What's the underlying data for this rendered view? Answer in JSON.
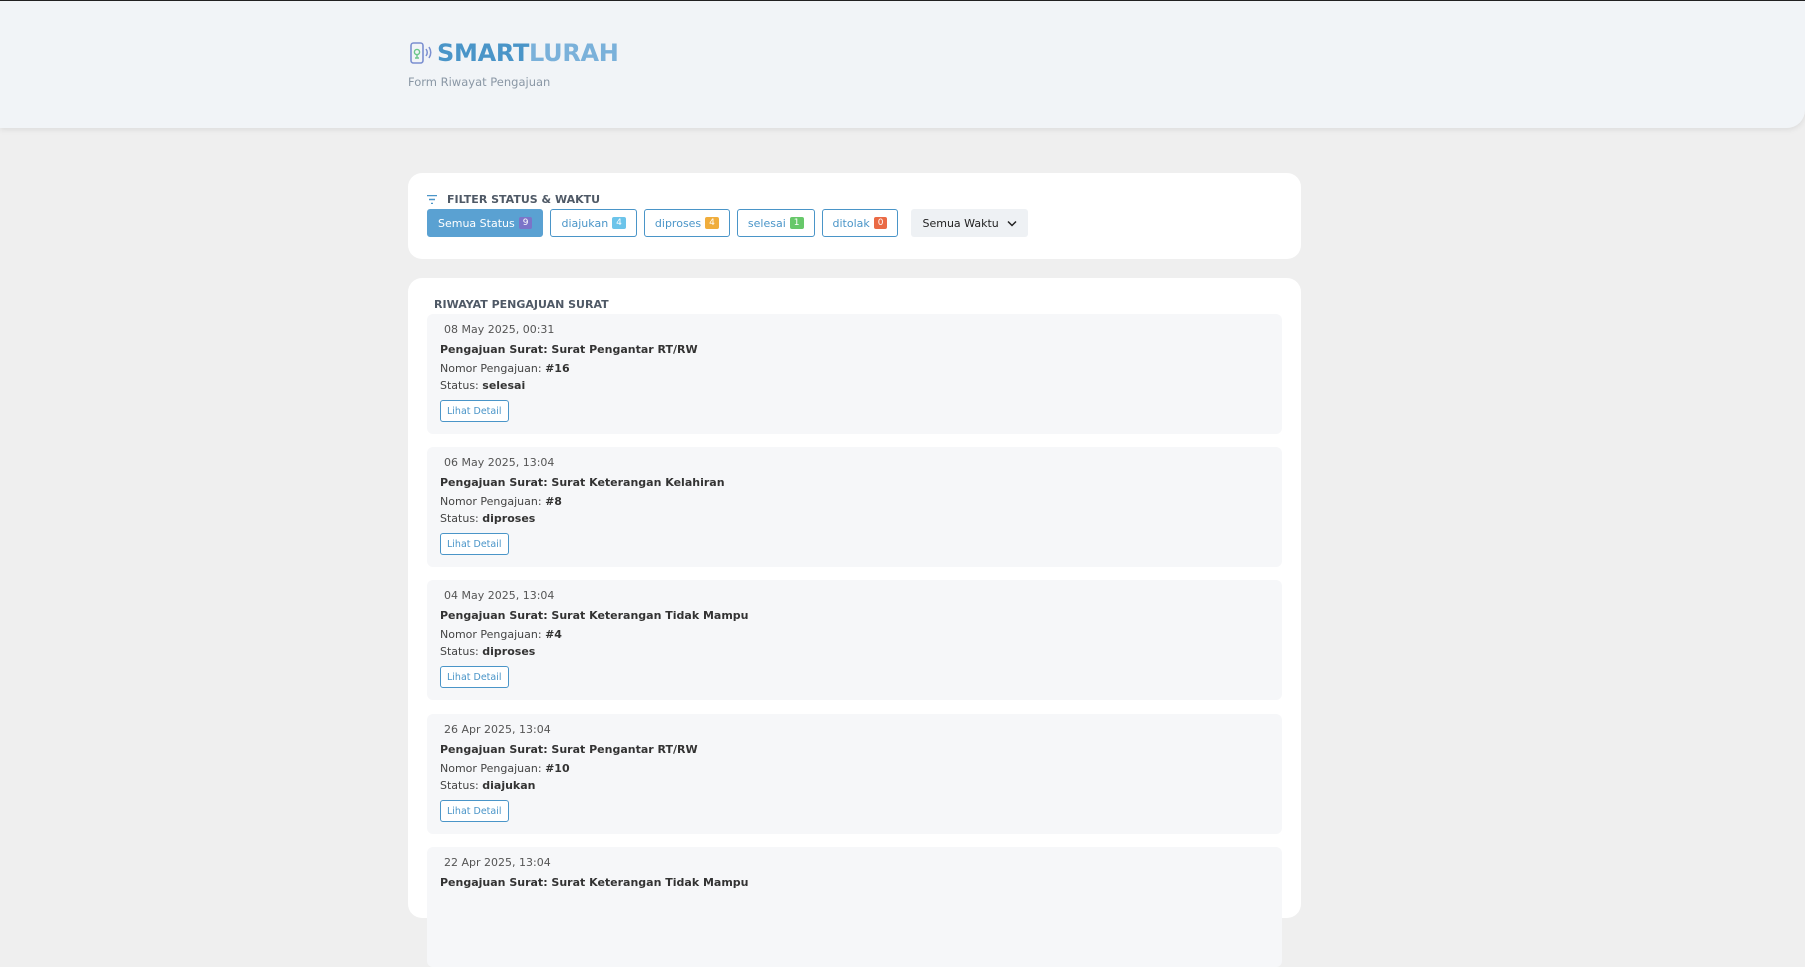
{
  "header": {
    "brand_part1": "SMART",
    "brand_part2": "LURAH",
    "subtitle": "Form Riwayat Pengajuan"
  },
  "filter": {
    "title": "FILTER STATUS & WAKTU",
    "chips": [
      {
        "label": "Semua Status",
        "count": "9",
        "active": true,
        "badge_color": "#7b74c8"
      },
      {
        "label": "diajukan",
        "count": "4",
        "active": false,
        "badge_color": "#6cc4ea"
      },
      {
        "label": "diproses",
        "count": "4",
        "active": false,
        "badge_color": "#f0ad3c"
      },
      {
        "label": "selesai",
        "count": "1",
        "active": false,
        "badge_color": "#67c86a"
      },
      {
        "label": "ditolak",
        "count": "0",
        "active": false,
        "badge_color": "#ea6a45"
      }
    ],
    "time_select_value": "Semua Waktu"
  },
  "history": {
    "title": "RIWAYAT PENGAJUAN SURAT",
    "nomor_label": "Nomor Pengajuan:",
    "status_label": "Status:",
    "detail_label": "Lihat Detail",
    "items": [
      {
        "date": "08 May 2025, 00:31",
        "title": "Pengajuan Surat: Surat Pengantar RT/RW",
        "nomor": "#16",
        "status": "selesai"
      },
      {
        "date": "06 May 2025, 13:04",
        "title": "Pengajuan Surat: Surat Keterangan Kelahiran",
        "nomor": "#8",
        "status": "diproses"
      },
      {
        "date": "04 May 2025, 13:04",
        "title": "Pengajuan Surat: Surat Keterangan Tidak Mampu",
        "nomor": "#4",
        "status": "diproses"
      },
      {
        "date": "26 Apr 2025, 13:04",
        "title": "Pengajuan Surat: Surat Pengantar RT/RW",
        "nomor": "#10",
        "status": "diajukan"
      },
      {
        "date": "22 Apr 2025, 13:04",
        "title": "Pengajuan Surat: Surat Keterangan Tidak Mampu",
        "nomor": "",
        "status": ""
      }
    ]
  },
  "colors": {
    "accent": "#4a95c8",
    "accent_light": "#7ab1da",
    "page_bg": "#efefef",
    "card_bg": "#ffffff",
    "item_bg": "#f6f7f9"
  },
  "icons": {
    "logo": "phone-signal-icon",
    "filter": "filter-icon",
    "select": "chevron-down-icon"
  }
}
